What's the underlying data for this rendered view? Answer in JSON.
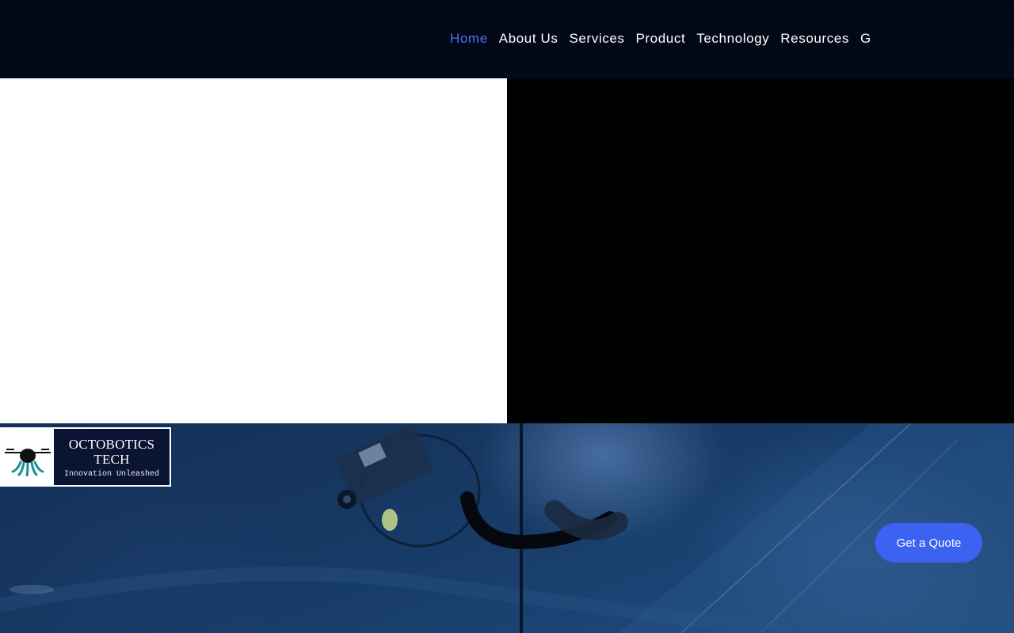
{
  "nav": {
    "items": [
      {
        "label": "Home",
        "active": true
      },
      {
        "label": "About Us",
        "active": false
      },
      {
        "label": "Services",
        "active": false
      },
      {
        "label": "Product",
        "active": false
      },
      {
        "label": "Technology",
        "active": false
      },
      {
        "label": "Resources",
        "active": false
      },
      {
        "label": "G",
        "active": false
      }
    ]
  },
  "logo": {
    "title_line1": "OCTOBOTICS",
    "title_line2": "TECH",
    "tagline": "Innovation Unleashed",
    "icon": "drone-octopus-icon"
  },
  "cta": {
    "label": "Get a Quote"
  },
  "colors": {
    "nav_active": "#4f6ff5",
    "cta_background": "#3b62f0",
    "header_background": "#020714",
    "logo_panel": "#0b1433"
  }
}
